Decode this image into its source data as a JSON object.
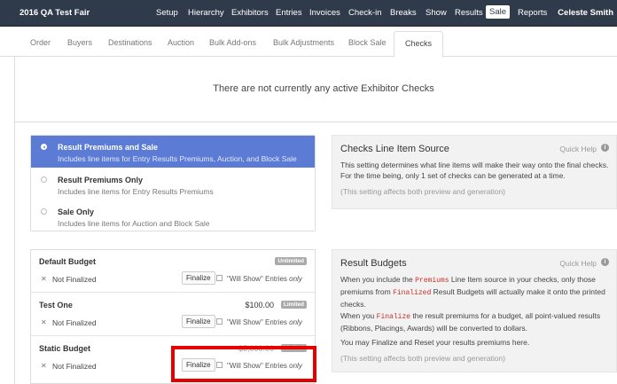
{
  "topnav": {
    "brand": "2016 QA Test Fair",
    "items": [
      "Setup",
      "Hierarchy",
      "Exhibitors",
      "Entries",
      "Invoices",
      "Check-in",
      "Breaks",
      "Show",
      "Results",
      "Sale",
      "Reports"
    ],
    "active": "Sale",
    "user": "Celeste Smith"
  },
  "subtabs": {
    "items": [
      "Order",
      "Buyers",
      "Destinations",
      "Auction",
      "Bulk Add-ons",
      "Bulk Adjustments",
      "Block Sale",
      "Checks"
    ],
    "active": "Checks"
  },
  "notice": "There are not currently any active Exhibitor Checks",
  "source_options": [
    {
      "title": "Result Premiums and Sale",
      "desc": "Includes line items for Entry Results Premiums, Auction, and Block Sale",
      "selected": true
    },
    {
      "title": "Result Premiums Only",
      "desc": "Includes line items for Entry Results Premiums",
      "selected": false
    },
    {
      "title": "Sale Only",
      "desc": "Includes line items for Auction and Block Sale",
      "selected": false
    }
  ],
  "help_source": {
    "title": "Checks Line Item Source",
    "quick_help": "Quick Help",
    "body": "This setting determines what line items will make their way onto the final checks. For the time being, only 1 set of checks can be generated at a time.",
    "note": "(This setting affects both preview and generation)"
  },
  "budgets": [
    {
      "name": "Default Budget",
      "amount": "",
      "badge": "Unlimited",
      "status": "Not Finalized",
      "finalize": "Finalize",
      "will_show": "\"Will Show\" Entries",
      "only": "only"
    },
    {
      "name": "Test One",
      "amount": "$100.00",
      "badge": "Limited",
      "status": "Not Finalized",
      "finalize": "Finalize",
      "will_show": "\"Will Show\" Entries",
      "only": "only"
    },
    {
      "name": "Static Budget",
      "amount": "$5,000.00",
      "badge": "Limited",
      "status": "Not Finalized",
      "finalize": "Finalize",
      "will_show": "\"Will Show\" Entries",
      "only": "only"
    }
  ],
  "help_budgets": {
    "title": "Result Budgets",
    "quick_help": "Quick Help",
    "p1_a": "When you include the",
    "p1_code": "Premiums",
    "p1_b": "Line Item source in your checks, only those premiums from",
    "p1_code2": "Finalized",
    "p1_c": "Result Budgets will actually make it onto the printed checks.",
    "p2_a": "When you",
    "p2_code": "Finalize",
    "p2_b": "the result premiums for a budget, all point-valued results (Ribbons, Placings, Awards) will be converted to dollars.",
    "p3": "You may Finalize and Reset your results premiums here.",
    "note": "(This setting affects both preview and generation)"
  },
  "colors": {
    "nav_bg": "#2f3b4a",
    "selected_option": "#5b7bd5",
    "highlight": "#e60000",
    "code_red": "#c9302c"
  }
}
